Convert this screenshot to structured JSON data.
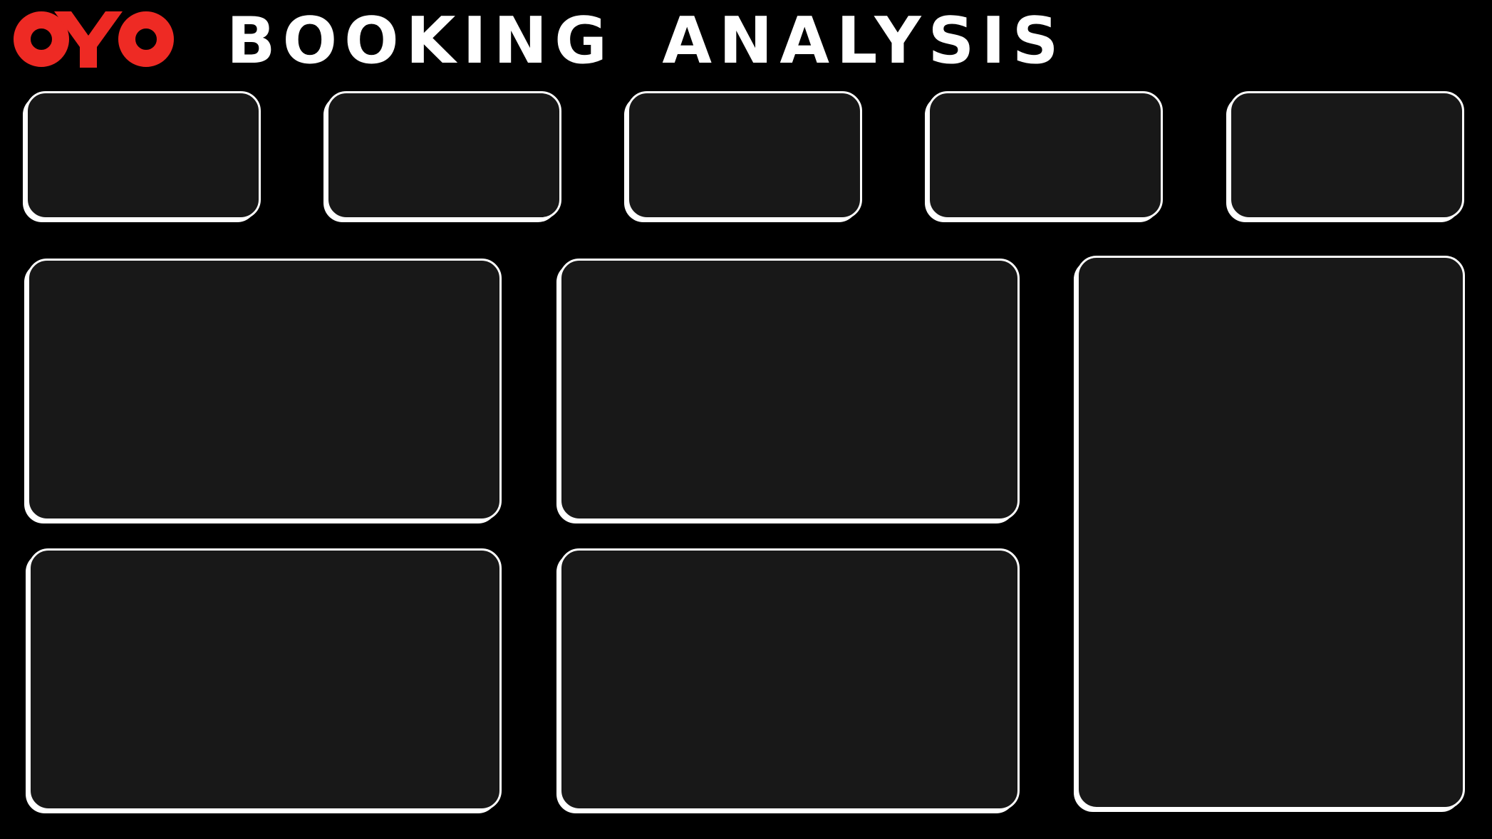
{
  "header": {
    "logo_text": "OYO",
    "title": "BOOKING ANALYSIS"
  },
  "colors": {
    "brand_red": "#ee2a24",
    "background": "#000000",
    "card_fill": "#181818",
    "card_border": "#ffffff",
    "title_text": "#ffffff"
  },
  "icons": {
    "logo": "oyo-logo-icon"
  },
  "kpi_cards": [
    {
      "label": ""
    },
    {
      "label": ""
    },
    {
      "label": ""
    },
    {
      "label": ""
    },
    {
      "label": ""
    }
  ],
  "panels": [
    {
      "label": ""
    },
    {
      "label": ""
    },
    {
      "label": ""
    },
    {
      "label": ""
    },
    {
      "label": ""
    }
  ]
}
